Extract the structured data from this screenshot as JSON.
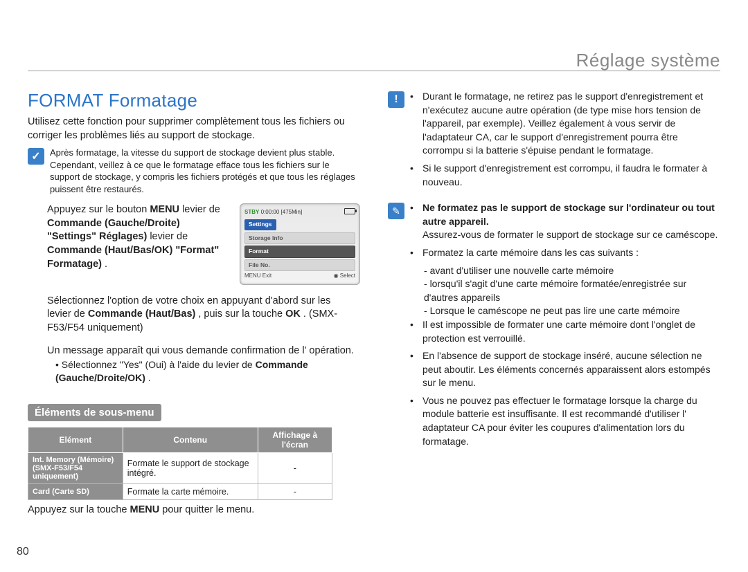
{
  "header": {
    "right": "Réglage système"
  },
  "title": "FORMAT Formatage",
  "intro": "Utilisez cette fonction pour supprimer complètement tous les fichiers ou corriger les problèmes liés au support de stockage.",
  "note_after_format": "Après formatage, la vitesse du support de stockage devient plus stable. Cependant, veillez à ce que le formatage efface tous les fichiers sur le support de stockage, y compris les fichiers protégés et que tous les réglages puissent être restaurés.",
  "steps": {
    "s1": {
      "num": "",
      "pre": "Appuyez sur le bouton ",
      "menu": "MENU",
      "mid1": "  levier de ",
      "lever1": "Commande (Gauche/Droite)",
      "mid2": "  \"Settings\" ",
      "settings": "Réglages)",
      "mid3": "  levier de ",
      "lever2": "Commande (Haut/Bas/OK)",
      "mid4": "  \"Format\" ",
      "format": "Formatage)",
      "end": "."
    },
    "s2": {
      "num": "",
      "line1": "Sélectionnez l'option de votre choix en appuyant d'abord sur les",
      "line2_pre": "levier de ",
      "line2_bold": "Commande (Haut/Bas)",
      "line2_mid": ", puis sur la touche ",
      "line2_ok": "OK",
      "line2_end": ". (SMX-F53/F54 uniquement)"
    },
    "s3": {
      "num": "",
      "line1": "Un message apparaît qui vous demande confirmation de l' opération.",
      "sub_pre": "Sélectionnez \"Yes\" (Oui) à l'aide du levier de ",
      "sub_bold": "Commande (Gauche/Droite/OK)",
      "sub_end": "."
    },
    "foot": {
      "num": "",
      "pre": "Appuyez sur la touche ",
      "menu": "MENU",
      "end": " pour quitter le menu."
    }
  },
  "subhead": "Éléments de sous-menu",
  "table": {
    "headers": {
      "c1": "Elément",
      "c2": "Contenu",
      "c3": "Affichage à l'écran"
    },
    "r1": {
      "c1a": "Int. Memory (Mémoire)",
      "c1b": "(SMX-F53/F54 uniquement)",
      "c2": "Formate le support de stockage intégré.",
      "c3": "-"
    },
    "r2": {
      "c1": "Card (Carte SD)",
      "c2": "Formate la carte mémoire.",
      "c3": "-"
    }
  },
  "screen": {
    "stby": "STBY",
    "time": "0:00:00",
    "remain": "[475Min]",
    "tab": "Settings",
    "row1": "Storage Info",
    "row2": "Format",
    "row3": "File No.",
    "foot_l": "MENU Exit",
    "foot_r": "◉ Select"
  },
  "right_warn": {
    "b1": "Durant le formatage, ne retirez pas le support d'enregistrement et n'exécutez aucune autre opération (de type mise hors tension de l'appareil, par exemple). Veillez également à vous servir de l'adaptateur CA, car le support d'enregistrement pourra être corrompu si la batterie s'épuise pendant le formatage.",
    "b2": "Si le support d'enregistrement est corrompu, il faudra le formater à nouveau."
  },
  "right_notes": {
    "n1_bold": "Ne formatez pas le support de stockage sur l'ordinateur ou tout autre appareil.",
    "n1_line": "Assurez-vous de formater le support de stockage sur ce caméscope.",
    "n2": "Formatez la carte mémoire dans les cas suivants :",
    "n2a": "avant d'utiliser une nouvelle carte mémoire",
    "n2b": "lorsqu'il s'agit d'une carte mémoire formatée/enregistrée sur d'autres appareils",
    "n2c": "Lorsque le caméscope ne peut pas lire une carte mémoire",
    "n3": "Il est impossible de formater une carte mémoire dont l'onglet de protection est verrouillé.",
    "n4": "En l'absence de support de stockage inséré, aucune sélection ne peut aboutir. Les éléments concernés apparaissent alors estompés sur le menu.",
    "n5": "Vous ne pouvez pas effectuer le formatage lorsque la charge du module batterie est insuffisante. Il est recommandé d'utiliser l' adaptateur CA pour éviter les coupures d'alimentation lors du formatage."
  },
  "page_number": "80"
}
